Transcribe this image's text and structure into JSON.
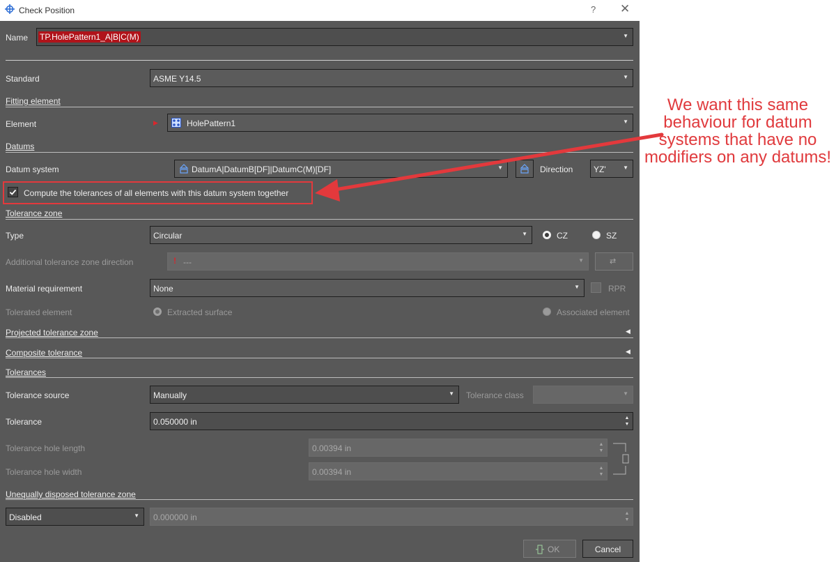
{
  "window": {
    "title": "Check Position",
    "help": "?",
    "close": "✕"
  },
  "name_field": {
    "label": "Name",
    "value": "TP.HolePattern1_A|B|C(M)"
  },
  "standard": {
    "label": "Standard",
    "value": "ASME Y14.5"
  },
  "fitting_element": {
    "section": "Fitting element",
    "element_label": "Element",
    "element_value": "HolePattern1"
  },
  "datums": {
    "section": "Datums",
    "datum_system_label": "Datum system",
    "datum_system_value": "DatumA|DatumB[DF]|DatumC(M)[DF]",
    "direction_label": "Direction",
    "direction_value": "YZ'",
    "compute_together_label": "Compute the tolerances of all elements with this datum system together",
    "compute_together_checked": true
  },
  "tolerance_zone": {
    "section": "Tolerance zone",
    "type_label": "Type",
    "type_value": "Circular",
    "cz_label": "CZ",
    "sz_label": "SZ",
    "additional_direction_label": "Additional tolerance zone direction",
    "additional_direction_value": "---",
    "material_requirement_label": "Material requirement",
    "material_requirement_value": "None",
    "rpr_label": "RPR",
    "toleranced_element_label": "Tolerated element",
    "extracted_surface_label": "Extracted surface",
    "associated_element_label": "Associated element"
  },
  "projected_tolerance_zone": {
    "section": "Projected tolerance zone"
  },
  "composite_tolerance": {
    "section": "Composite tolerance"
  },
  "tolerances": {
    "section": "Tolerances",
    "source_label": "Tolerance source",
    "source_value": "Manually",
    "class_label": "Tolerance class",
    "class_value": "",
    "tolerance_label": "Tolerance",
    "tolerance_value": "0.050000 in",
    "hole_length_label": "Tolerance hole length",
    "hole_length_value": "0.00394 in",
    "hole_width_label": "Tolerance hole width",
    "hole_width_value": "0.00394 in"
  },
  "unequal_zone": {
    "section": "Unequally disposed tolerance zone",
    "mode_value": "Disabled",
    "amount_value": "0.000000 in"
  },
  "buttons": {
    "ok": "OK",
    "cancel": "Cancel"
  },
  "annotation": {
    "text": "We want this same behaviour for datum systems that have no modifiers on any datums!",
    "color": "#e03a3d"
  },
  "colors": {
    "dialog_bg": "#585858",
    "highlight_red": "#e3393c",
    "name_highlight": "#b0131a"
  }
}
